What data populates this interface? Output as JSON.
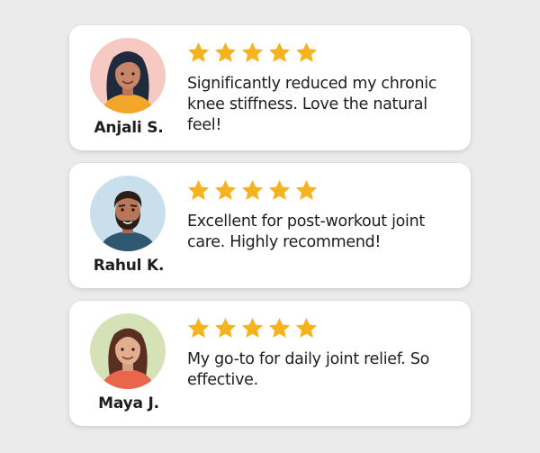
{
  "colors": {
    "background": "#ebebeb",
    "card": "#ffffff",
    "star": "#f5b320",
    "text": "#1e1e1e"
  },
  "testimonials": [
    {
      "name": "Anjali S.",
      "rating": 5,
      "review": "Significantly reduced my chronic knee stiffness. Love the natural feel!",
      "avatar_icon": "woman-avatar-icon",
      "avatar_bg": "#f6c9c3"
    },
    {
      "name": "Rahul K.",
      "rating": 5,
      "review": "Excellent for post-workout joint care. Highly recommend!",
      "avatar_icon": "bearded-man-avatar-icon",
      "avatar_bg": "#c9e0ec"
    },
    {
      "name": "Maya J.",
      "rating": 5,
      "review": "My go-to for daily joint relief. So effective.",
      "avatar_icon": "woman-avatar-icon",
      "avatar_bg": "#d5e2b5"
    }
  ]
}
